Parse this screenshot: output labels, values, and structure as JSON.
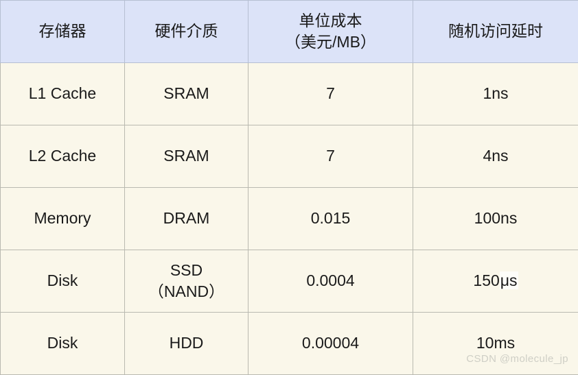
{
  "table": {
    "headers": [
      {
        "label": "存储器"
      },
      {
        "label": "硬件介质"
      },
      {
        "label_line1": "单位成本",
        "label_line2": "（美元/MB）"
      },
      {
        "label": "随机访问延时"
      }
    ],
    "rows": [
      {
        "storage": "L1 Cache",
        "medium": "SRAM",
        "medium_line2": "",
        "cost_usd_per_mb": "7",
        "random_access_latency": "1ns",
        "latency_prefix": "1ns",
        "latency_highlight": ""
      },
      {
        "storage": "L2 Cache",
        "medium": "SRAM",
        "medium_line2": "",
        "cost_usd_per_mb": "7",
        "random_access_latency": "4ns",
        "latency_prefix": "4ns",
        "latency_highlight": ""
      },
      {
        "storage": "Memory",
        "medium": "DRAM",
        "medium_line2": "",
        "cost_usd_per_mb": "0.015",
        "random_access_latency": "100ns",
        "latency_prefix": "100ns",
        "latency_highlight": ""
      },
      {
        "storage": "Disk",
        "medium": "SSD",
        "medium_line2": "（NAND）",
        "cost_usd_per_mb": "0.0004",
        "random_access_latency": "150μs",
        "latency_prefix": "150",
        "latency_highlight": "μs"
      },
      {
        "storage": "Disk",
        "medium": "HDD",
        "medium_line2": "",
        "cost_usd_per_mb": "0.00004",
        "random_access_latency": "10ms",
        "latency_prefix": "10ms",
        "latency_highlight": ""
      }
    ]
  },
  "watermark": {
    "text": "CSDN @molecule_jp"
  },
  "colors": {
    "header_background": "#dce3f8",
    "body_background": "#faf7ea",
    "border": "#b9b9b0",
    "text": "#1a1a1a",
    "watermark_text": "#cfcfc6"
  }
}
